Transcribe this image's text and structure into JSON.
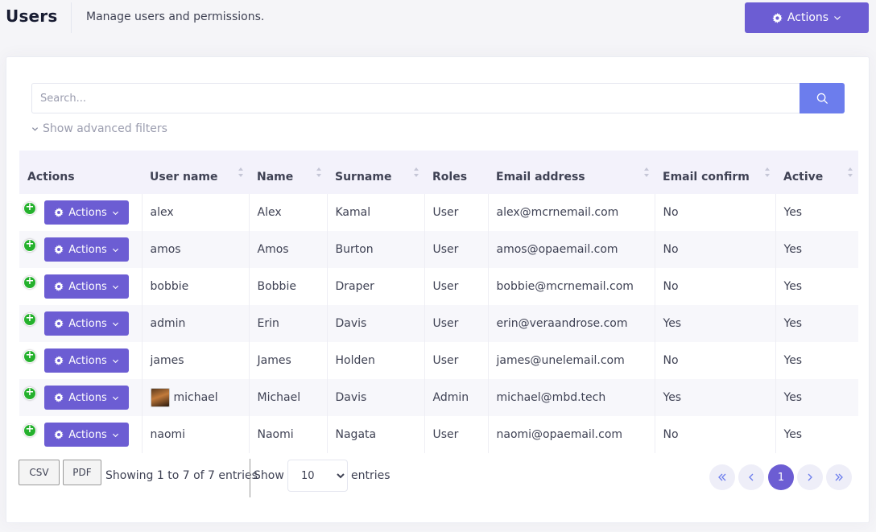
{
  "header": {
    "title": "Users",
    "subtitle": "Manage users and permissions.",
    "actions_label": "Actions"
  },
  "search": {
    "placeholder": "Search...",
    "advanced_filters_label": "Show advanced filters"
  },
  "table": {
    "columns": [
      "Actions",
      "User name",
      "Name",
      "Surname",
      "Roles",
      "Email address",
      "Email confirm",
      "Active"
    ],
    "row_action_label": "Actions",
    "rows": [
      {
        "username": "alex",
        "name": "Alex",
        "surname": "Kamal",
        "roles": "User",
        "email": "alex@mcrnemail.com",
        "email_confirm": "No",
        "active": "Yes",
        "has_avatar": false
      },
      {
        "username": "amos",
        "name": "Amos",
        "surname": "Burton",
        "roles": "User",
        "email": "amos@opaemail.com",
        "email_confirm": "No",
        "active": "Yes",
        "has_avatar": false
      },
      {
        "username": "bobbie",
        "name": "Bobbie",
        "surname": "Draper",
        "roles": "User",
        "email": "bobbie@mcrnemail.com",
        "email_confirm": "No",
        "active": "Yes",
        "has_avatar": false
      },
      {
        "username": "admin",
        "name": "Erin",
        "surname": "Davis",
        "roles": "User",
        "email": "erin@veraandrose.com",
        "email_confirm": "Yes",
        "active": "Yes",
        "has_avatar": false
      },
      {
        "username": "james",
        "name": "James",
        "surname": "Holden",
        "roles": "User",
        "email": "james@unelemail.com",
        "email_confirm": "No",
        "active": "Yes",
        "has_avatar": false
      },
      {
        "username": "michael",
        "name": "Michael",
        "surname": "Davis",
        "roles": "Admin",
        "email": "michael@mbd.tech",
        "email_confirm": "Yes",
        "active": "Yes",
        "has_avatar": true
      },
      {
        "username": "naomi",
        "name": "Naomi",
        "surname": "Nagata",
        "roles": "User",
        "email": "naomi@opaemail.com",
        "email_confirm": "No",
        "active": "Yes",
        "has_avatar": false
      }
    ]
  },
  "footer": {
    "csv_label": "CSV",
    "pdf_label": "PDF",
    "showing_text": "Showing 1 to 7 of 7 entries",
    "show_label": "Show",
    "page_size": "10",
    "entries_label": "entries",
    "current_page": "1"
  },
  "icons": {
    "gear": "gear-icon",
    "chevron": "chevron-down-icon",
    "search": "search-icon",
    "plus": "plus-circle-icon",
    "sort": "sort-icon",
    "first": "double-chevron-left-icon",
    "prev": "chevron-left-icon",
    "next": "chevron-right-icon",
    "last": "double-chevron-right-icon"
  },
  "colors": {
    "primary": "#6c5dd3",
    "search_button": "#6c7ded",
    "expand_green": "#25b12d",
    "header_bg": "#f3f2fb"
  }
}
